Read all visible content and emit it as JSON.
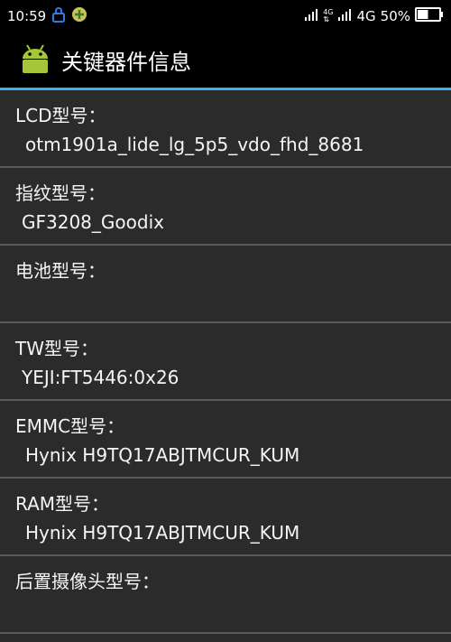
{
  "status_bar": {
    "time": "10:59",
    "network_label": "4G",
    "small_network_label": "4G",
    "battery_percent": "50%",
    "battery_level": 0.5
  },
  "action_bar": {
    "title": "关键器件信息",
    "app_icon": "android-robot-icon"
  },
  "items": [
    {
      "label": "LCD型号：",
      "value": "otm1901a_lide_lg_5p5_vdo_fhd_8681"
    },
    {
      "label": "指纹型号：",
      "value": "GF3208_Goodix"
    },
    {
      "label": "电池型号：",
      "value": ""
    },
    {
      "label": "TW型号：",
      "value": "YEJI:FT5446:0x26"
    },
    {
      "label": "EMMC型号：",
      "value": "Hynix H9TQ17ABJTMCUR_KUM"
    },
    {
      "label": "RAM型号：",
      "value": "Hynix H9TQ17ABJTMCUR_KUM"
    },
    {
      "label": "后置摄像头型号：",
      "value": ""
    }
  ],
  "colors": {
    "accent_line": "#33b5e5",
    "background": "#2b2b2b",
    "bar_background": "#000000"
  }
}
